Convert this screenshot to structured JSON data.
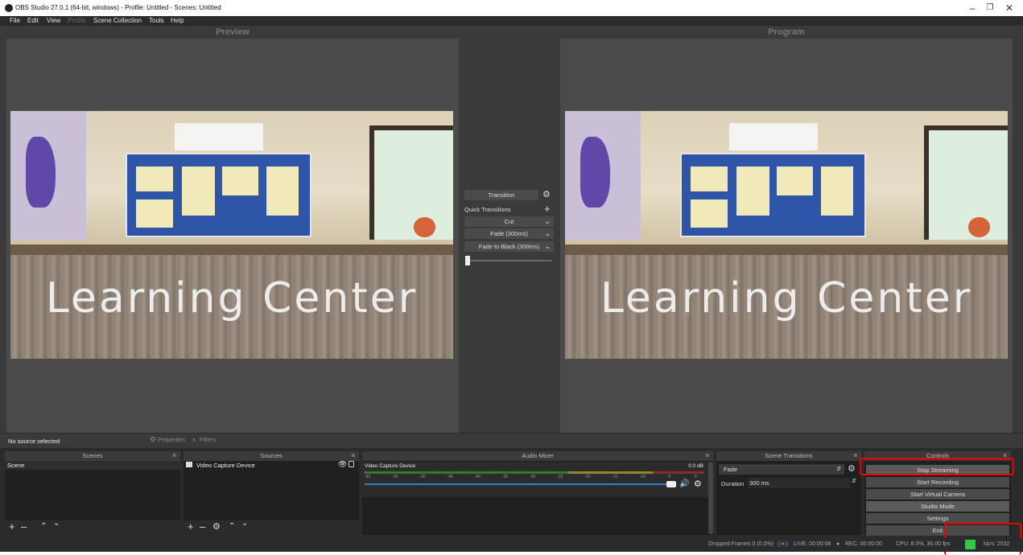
{
  "window": {
    "title": "OBS Studio 27.0.1 (64-bit, windows) - Profile: Untitled - Scenes: Untitled",
    "minimize_icon": "minimize-icon",
    "restore_icon": "restore-icon",
    "close_icon": "close-icon"
  },
  "menu": {
    "file": "File",
    "edit": "Edit",
    "view": "View",
    "profile": "Profile",
    "scene_collection": "Scene Collection",
    "tools": "Tools",
    "help": "Help"
  },
  "preview": {
    "label": "Preview",
    "scene_text": "Learning  Center"
  },
  "program": {
    "label": "Program",
    "scene_text": "Learning  Center"
  },
  "transitions_panel": {
    "transition_button": "Transition",
    "quick_transitions": "Quick Transitions",
    "items": [
      "Cut",
      "Fade (300ms)",
      "Fade to Black (300ms)"
    ]
  },
  "source_bar": {
    "status": "No source selected",
    "properties": "Properties",
    "filters": "Filters"
  },
  "docks": {
    "scenes": {
      "title": "Scenes",
      "items": [
        "Scene"
      ]
    },
    "sources": {
      "title": "Sources",
      "items": [
        "Video Capture Device"
      ]
    },
    "audio_mixer": {
      "title": "Audio Mixer",
      "channel_name": "Video Capture Device",
      "level": "0.0 dB",
      "scale": [
        "-60",
        "-55",
        "-50",
        "-45",
        "-40",
        "-35",
        "-30",
        "-25",
        "-20",
        "-15",
        "-10",
        "-5",
        "0"
      ]
    },
    "scene_transitions": {
      "title": "Scene Transitions",
      "selected": "Fade",
      "duration_label": "Duration",
      "duration_value": "300 ms"
    },
    "controls": {
      "title": "Controls",
      "buttons": [
        "Stop Streaming",
        "Start Recording",
        "Start Virtual Camera",
        "Studio Mode",
        "Settings",
        "Exit"
      ]
    }
  },
  "status_bar": {
    "dropped_frames": "Dropped Frames 0 (0.0%)",
    "live": "LIVE: 00:00:08",
    "rec": "REC: 00:00:00",
    "cpu": "CPU: 8.0%, 30.00 fps",
    "bitrate": "kb/s: 2532",
    "stream_status_color": "#2ecc40"
  },
  "colors": {
    "highlight": "#e00000",
    "background_dark": "#2b2b2b",
    "panel": "#3a3a3a"
  }
}
